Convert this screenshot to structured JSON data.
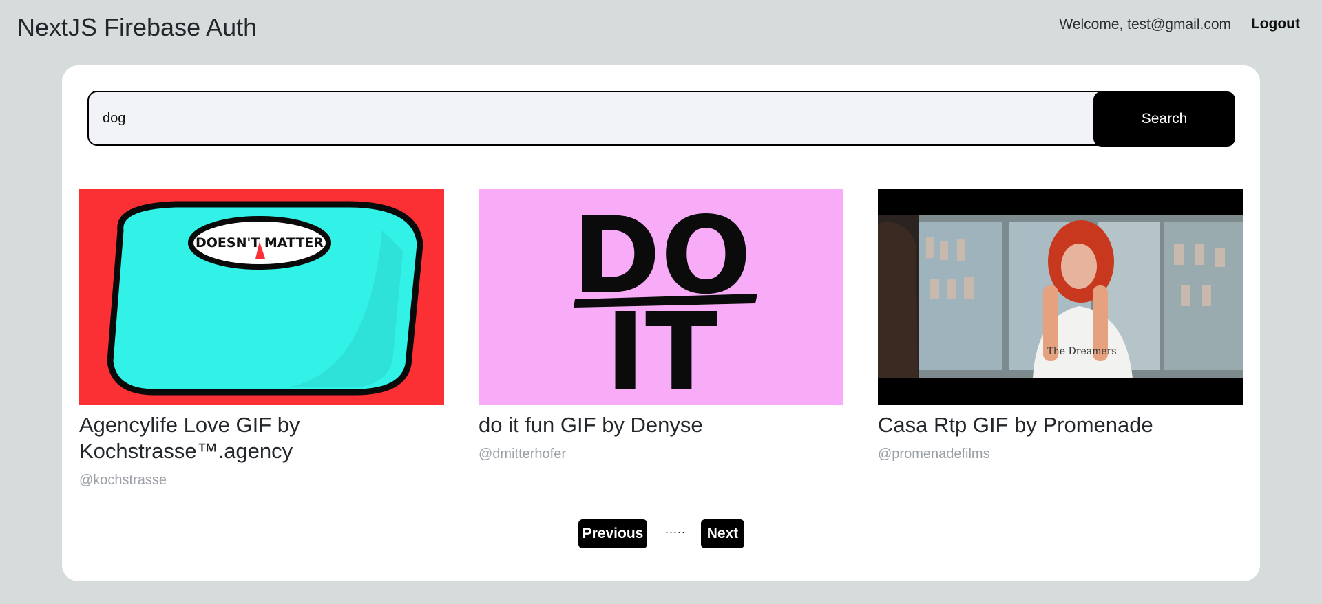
{
  "header": {
    "app_title": "NextJS Firebase Auth",
    "welcome_text": "Welcome, test@gmail.com",
    "logout_label": "Logout"
  },
  "search": {
    "value": "dog",
    "button_label": "Search"
  },
  "results": [
    {
      "title": "Agencylife Love GIF by Kochstrasse™.agency",
      "username": "@kochstrasse",
      "thumb_text": "DOESN'T MATTER"
    },
    {
      "title": "do it fun GIF by Denyse",
      "username": "@dmitterhofer",
      "thumb_text_line1": "DO",
      "thumb_text_line2": "IT"
    },
    {
      "title": "Casa Rtp GIF by Promenade",
      "username": "@promenadefilms",
      "thumb_text": "The Dreamers"
    }
  ],
  "pagination": {
    "previous_label": "Previous",
    "separator": ".....",
    "next_label": "Next"
  },
  "colors": {
    "page_background": "#d6dcdc",
    "card_background": "#ffffff",
    "button_background": "#000000",
    "input_background": "#f1f3f6"
  }
}
